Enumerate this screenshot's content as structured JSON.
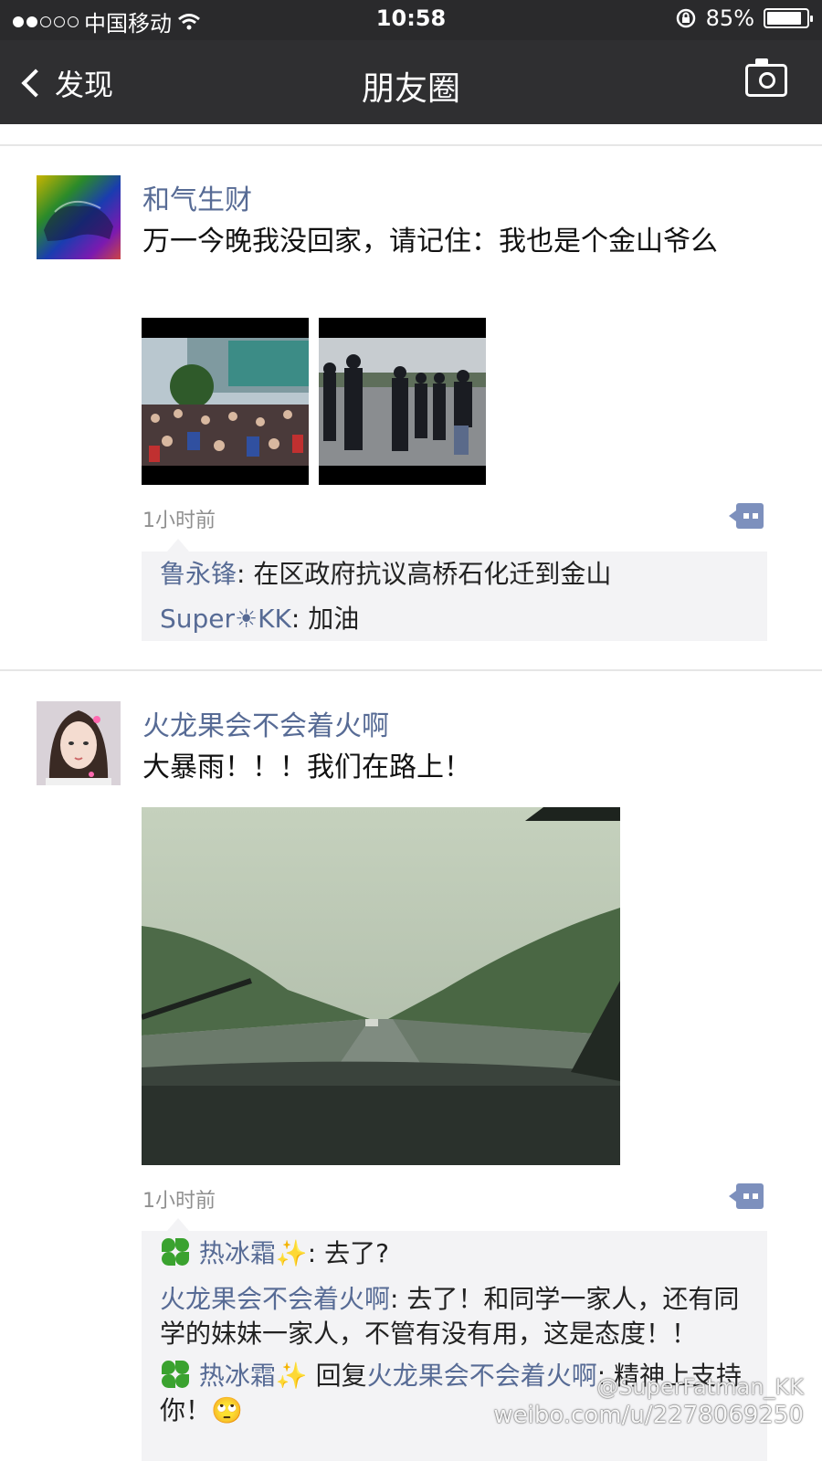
{
  "status_bar": {
    "carrier": "中国移动",
    "time": "10:58",
    "battery": "85%"
  },
  "nav": {
    "back_label": "发现",
    "title": "朋友圈"
  },
  "posts": [
    {
      "author": "和气生财",
      "text": "万一今晚我没回家，请记住：我也是个金山爷么",
      "timestamp": "1小时前",
      "comments": [
        {
          "user": "鲁永锋",
          "text": ": 在区政府抗议高桥石化迁到金山"
        },
        {
          "user": "Super☀KK",
          "text": ": 加油"
        }
      ]
    },
    {
      "author": "火龙果会不会着火啊",
      "text": "大暴雨！！！我们在路上！",
      "timestamp": "1小时前",
      "comments": [
        {
          "user": "热冰霜✨",
          "text": ": 去了?"
        },
        {
          "user": "火龙果会不会着火啊",
          "text": ": 去了！和同学一家人，还有同学的妹妹一家人，不管有没有用，这是态度！！"
        },
        {
          "user": "热冰霜✨",
          "reply_word": " 回复",
          "reply_to": "火龙果会不会着火啊",
          "text": ": 精神上支持你！🙄"
        }
      ]
    }
  ],
  "watermark": {
    "handle": "@SuperFatman_KK",
    "url": "weibo.com/u/2278069250"
  }
}
